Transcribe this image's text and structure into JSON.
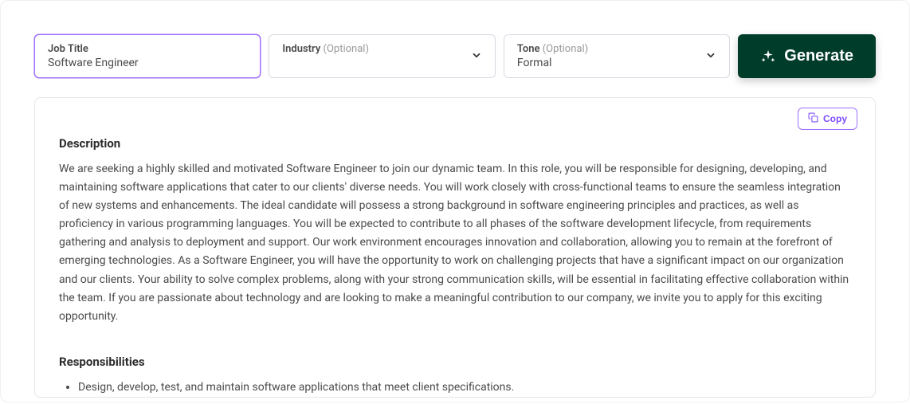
{
  "form": {
    "jobTitle": {
      "label": "Job Title",
      "value": "Software Engineer"
    },
    "industry": {
      "label": "Industry",
      "optional": "(Optional)",
      "value": ""
    },
    "tone": {
      "label": "Tone",
      "optional": "(Optional)",
      "value": "Formal"
    },
    "generateLabel": "Generate"
  },
  "output": {
    "copyLabel": "Copy",
    "descriptionHeading": "Description",
    "descriptionBody": "We are seeking a highly skilled and motivated Software Engineer to join our dynamic team. In this role, you will be responsible for designing, developing, and maintaining software applications that cater to our clients' diverse needs. You will work closely with cross-functional teams to ensure the seamless integration of new systems and enhancements. The ideal candidate will possess a strong background in software engineering principles and practices, as well as proficiency in various programming languages. You will be expected to contribute to all phases of the software development lifecycle, from requirements gathering and analysis to deployment and support. Our work environment encourages innovation and collaboration, allowing you to remain at the forefront of emerging technologies. As a Software Engineer, you will have the opportunity to work on challenging projects that have a significant impact on our organization and our clients. Your ability to solve complex problems, along with your strong communication skills, will be essential in facilitating effective collaboration within the team. If you are passionate about technology and are looking to make a meaningful contribution to our company, we invite you to apply for this exciting opportunity.",
    "responsibilitiesHeading": "Responsibilities",
    "responsibilities": [
      "Design, develop, test, and maintain software applications that meet client specifications."
    ]
  }
}
